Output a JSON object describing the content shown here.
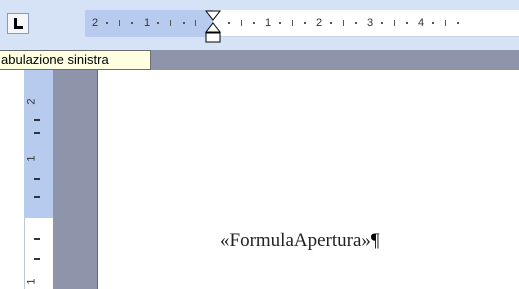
{
  "tab_selector": {
    "icon": "left-tab-icon"
  },
  "ruler": {
    "numbers": [
      "2",
      "1",
      "1",
      "2",
      "3",
      "4"
    ],
    "indent_icon": "hanging-indent-marker-icon"
  },
  "tooltip": {
    "text": "abulazione sinistra"
  },
  "vertical_ruler": {
    "numbers": [
      "2",
      "1",
      "1"
    ]
  },
  "document": {
    "merge_field": "«FormulaApertura»",
    "pilcrow": "¶"
  },
  "colors": {
    "ruler_margin": "#b7cbee",
    "toolbar_bg": "#d6e3f7",
    "gutter": "#8e95aa",
    "tooltip_bg": "#ffffe1"
  }
}
